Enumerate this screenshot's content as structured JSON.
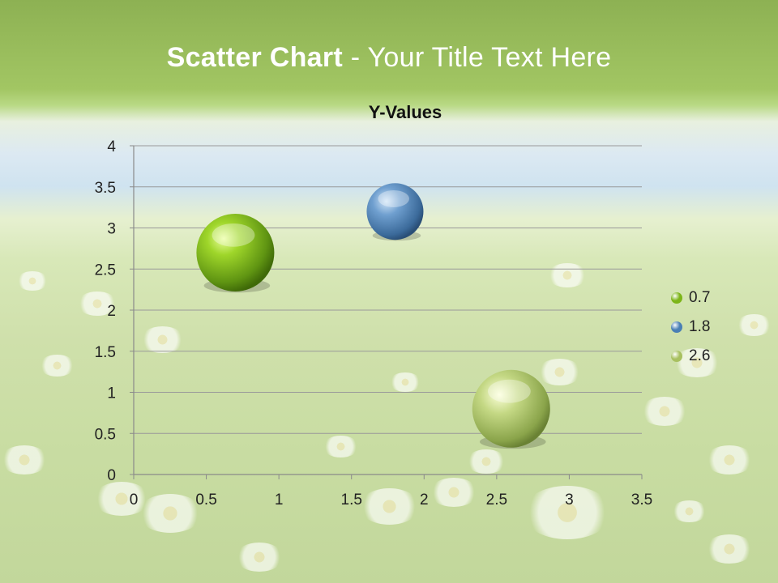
{
  "slide": {
    "title_bold": "Scatter Chart",
    "title_rest": " - Your Title Text Here"
  },
  "chart_data": {
    "type": "scatter",
    "title": "Y-Values",
    "xlim": [
      0,
      3.5
    ],
    "ylim": [
      0,
      4
    ],
    "x_ticks": [
      "0",
      "0.5",
      "1",
      "1.5",
      "2",
      "2.5",
      "3",
      "3.5"
    ],
    "y_ticks": [
      "0",
      "0.5",
      "1",
      "1.5",
      "2",
      "2.5",
      "3",
      "3.5",
      "4"
    ],
    "grid": true,
    "legend_position": "right",
    "points": [
      {
        "label": "0.7",
        "x": 0.7,
        "y": 2.7,
        "color": "#7cb518",
        "size_level": 3
      },
      {
        "label": "1.8",
        "x": 1.8,
        "y": 3.2,
        "color": "#4a7fb5",
        "size_level": 2
      },
      {
        "label": "2.6",
        "x": 2.6,
        "y": 0.8,
        "color": "#a8c060",
        "size_level": 3
      }
    ]
  }
}
